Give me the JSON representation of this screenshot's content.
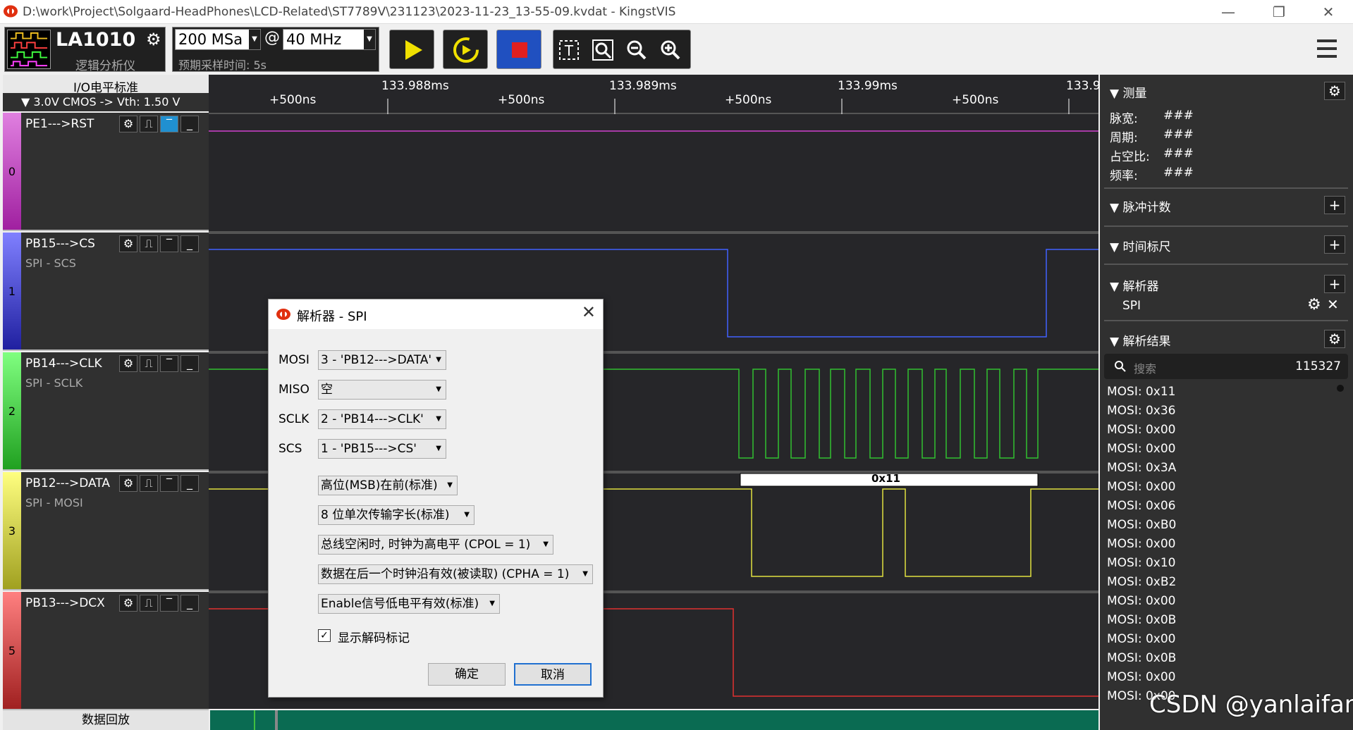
{
  "window": {
    "title": "D:\\work\\Project\\Solgaard-HeadPhones\\LCD-Related\\ST7789V\\231123\\2023-11-23_13-55-09.kvdat - KingstVIS",
    "minimize": "—",
    "maximize": "❐",
    "close": "✕"
  },
  "toolbar": {
    "device_name": "LA1010",
    "device_sub": "逻辑分析仪",
    "sample_count": "200 MSa",
    "at": "@",
    "sample_rate": "40 MHz",
    "expected_time": "预期采样时间: 5s"
  },
  "channels_header": {
    "title": "I/O电平标准",
    "level": "▼ 3.0V CMOS -> Vth: 1.50 V"
  },
  "channels": [
    {
      "index": "0",
      "name": "PE1--->RST",
      "proto": "",
      "color": "#c040c0"
    },
    {
      "index": "1",
      "name": "PB15--->CS",
      "proto": "SPI - SCS",
      "color": "#4040d0"
    },
    {
      "index": "2",
      "name": "PB14--->CLK",
      "proto": "SPI - SCLK",
      "color": "#30b030"
    },
    {
      "index": "3",
      "name": "PB12--->DATA",
      "proto": "SPI - MOSI",
      "color": "#d0d030"
    },
    {
      "index": "5",
      "name": "PB13--->DCX",
      "proto": "",
      "color": "#d03030"
    }
  ],
  "ruler": {
    "t1": "133.988ms",
    "t2": "133.989ms",
    "t3": "133.99ms",
    "t4": "133.9",
    "sub": "+500ns"
  },
  "decode_label": "0x11",
  "right_panel": {
    "measure_title": "测量",
    "pulse_width_label": "脉宽:",
    "pulse_width_value": "###",
    "period_label": "周期:",
    "period_value": "###",
    "duty_label": "占空比:",
    "duty_value": "###",
    "freq_label": "频率:",
    "freq_value": "###",
    "pulse_count_title": "脉冲计数",
    "time_ruler_title": "时间标尺",
    "analyzer_title": "解析器",
    "analyzer_item": "SPI",
    "results_title": "解析结果",
    "search_placeholder": "搜索",
    "results_count": "115327",
    "results": [
      "MOSI: 0x11",
      "MOSI: 0x36",
      "MOSI: 0x00",
      "MOSI: 0x00",
      "MOSI: 0x3A",
      "MOSI: 0x00",
      "MOSI: 0x06",
      "MOSI: 0xB0",
      "MOSI: 0x00",
      "MOSI: 0x10",
      "MOSI: 0xB2",
      "MOSI: 0x00",
      "MOSI: 0x0B",
      "MOSI: 0x00",
      "MOSI: 0x0B",
      "MOSI: 0x00",
      "MOSI: 0x00"
    ]
  },
  "playback": "数据回放",
  "dialog": {
    "title": "解析器 - SPI",
    "mosi_label": "MOSI",
    "mosi_value": "3 - 'PB12--->DATA'",
    "miso_label": "MISO",
    "miso_value": "空",
    "sclk_label": "SCLK",
    "sclk_value": "2 - 'PB14--->CLK'",
    "scs_label": "SCS",
    "scs_value": "1 - 'PB15--->CS'",
    "bit_order": "高位(MSB)在前(标准)",
    "word_len": "8 位单次传输字长(标准)",
    "cpol": "总线空闲时, 时钟为高电平 (CPOL = 1)",
    "cpha": "数据在后一个时钟沿有效(被读取) (CPHA = 1)",
    "enable": "Enable信号低电平有效(标准)",
    "show_marks": "显示解码标记",
    "ok": "确定",
    "cancel": "取消"
  },
  "watermark": "CSDN @yanlaifan"
}
